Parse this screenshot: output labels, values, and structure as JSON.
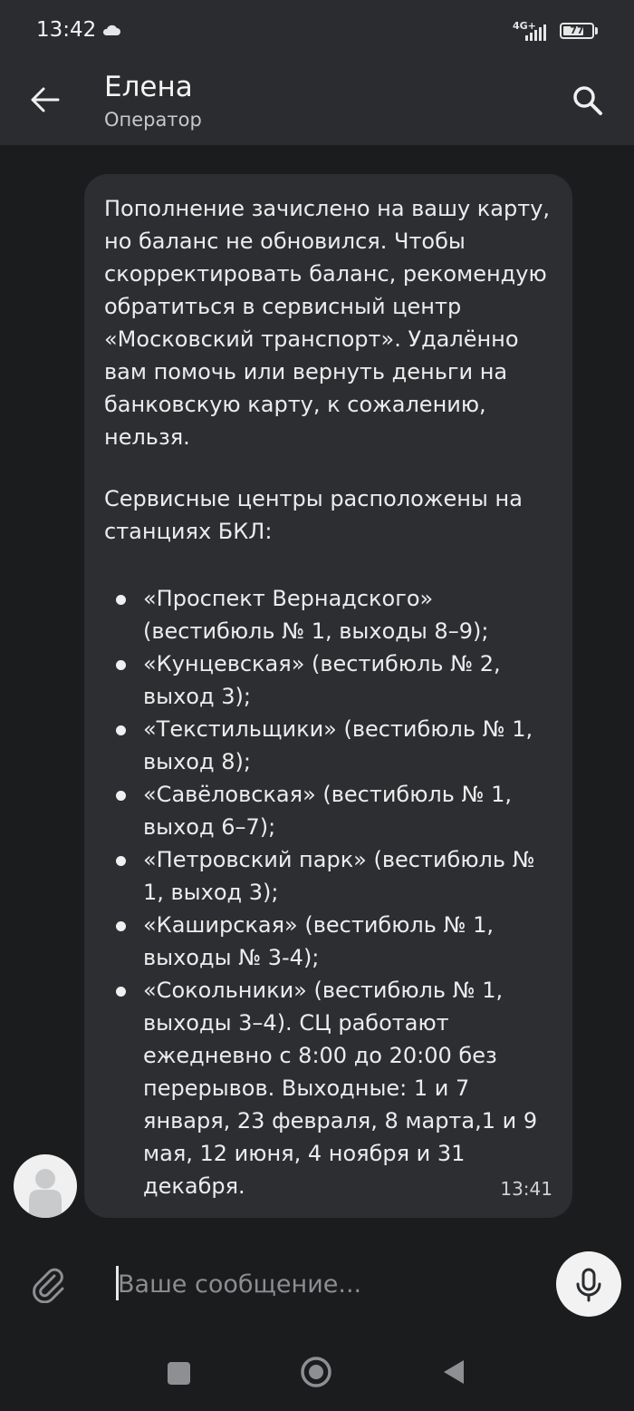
{
  "status_bar": {
    "time": "13:42",
    "network": "4G+",
    "battery": "77",
    "battery_level": 0.77
  },
  "header": {
    "title": "Елена",
    "subtitle": "Оператор"
  },
  "message": {
    "paragraph1": "Пополнение зачислено на вашу карту, но баланс не обновился. Чтобы скорректировать баланс, рекомендую обратиться в сервисный центр «Московский транспорт». Удалённо вам помочь или вернуть деньги на банковскую карту, к сожалению, нельзя.",
    "paragraph2": "Сервисные центры расположены на станциях БКЛ:",
    "items": [
      "«Проспект Вернадского» (вестибюль № 1, выходы 8–9);",
      "«Кунцевская» (вестибюль № 2, выход 3);",
      "«Текстильщики» (вестибюль № 1, выход 8);",
      "«Савёловская» (вестибюль № 1, выход 6–7);",
      "«Петровский парк» (вестибюль № 1, выход 3);",
      "«Каширская» (вестибюль № 1, выходы № 3-4);",
      "«Сокольники» (вестибюль № 1, выходы 3–4). СЦ работают ежедневно с 8:00 до 20:00 без перерывов. Выходные: 1 и 7 января, 23 февраля, 8 марта,1 и 9 мая, 12 июня, 4 ноября и 31 декабря."
    ],
    "time": "13:41"
  },
  "composer": {
    "placeholder": "Ваше сообщение..."
  },
  "colors": {
    "background": "#1b1c1e",
    "bar": "#2b2c2f",
    "bubble": "#2d2e31",
    "text": "#ececed"
  }
}
